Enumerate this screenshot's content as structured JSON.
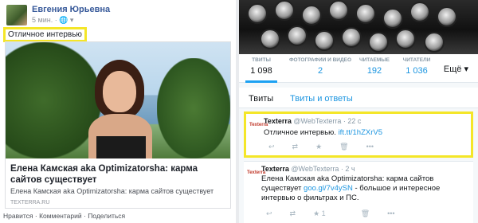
{
  "facebook": {
    "author": "Евгения Юрьевна",
    "meta": "5 мин. · ",
    "post_text": "Отличное интервью",
    "card": {
      "title": "Елена Камская aka Optimizatorsha: карма сайтов существует",
      "description": "Елена Камская aka Optimizatorsha: карма сайтов существует",
      "domain": "TEXTERRA.RU"
    },
    "actions": {
      "like": "Нравится",
      "comment": "Комментарий",
      "share": "Поделиться",
      "sep": " · "
    }
  },
  "twitter": {
    "stats": [
      {
        "label": "ТВИТЫ",
        "value": "1 098"
      },
      {
        "label": "ФОТОГРАФИИ И ВИДЕО",
        "value": "2"
      },
      {
        "label": "ЧИТАЕМЫЕ",
        "value": "192"
      },
      {
        "label": "ЧИТАТЕЛИ",
        "value": "1 036"
      }
    ],
    "more_label": "Ещё ▾",
    "tabs": [
      "Твиты",
      "Твиты и ответы"
    ],
    "tweets": [
      {
        "avatar_text": "Texterra",
        "name": "Texterra",
        "handle": "@WebTexterra",
        "time": " · 22 с",
        "text": "Отличное интервью.",
        "link": "ift.tt/1hZXrV5"
      },
      {
        "avatar_text": "Texterra",
        "name": "Texterra",
        "handle": "@WebTexterra",
        "time": " · 2 ч",
        "text": "Елена Камская aka Optimizatorsha: карма сайтов существует",
        "link": "goo.gl/7v4ySN",
        "text_after": " - большое и интересное интервью о фильтрах и ПС.",
        "favorite_count": "1"
      }
    ]
  },
  "icons": [
    "globe-icon",
    "reply-icon",
    "retweet-icon",
    "favorite-icon",
    "delete-icon",
    "more-icon"
  ]
}
